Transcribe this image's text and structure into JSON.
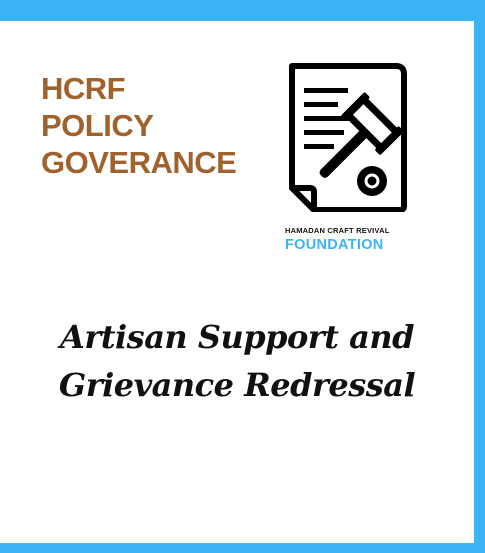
{
  "title": {
    "line1": "HCRF",
    "line2": "POLICY",
    "line3": "GOVERANCE"
  },
  "organization": {
    "line1": "HAMADAN CRAFT REVIVAL",
    "line2": "FOUNDATION"
  },
  "subtitle": {
    "line1": "Artisan Support and",
    "line2": "Grievance Redressal"
  },
  "icon": "document-gavel-icon",
  "colors": {
    "border": "#3bb4f5",
    "title": "#a0622d",
    "foundation": "#3bb4f5",
    "text": "#111111"
  }
}
